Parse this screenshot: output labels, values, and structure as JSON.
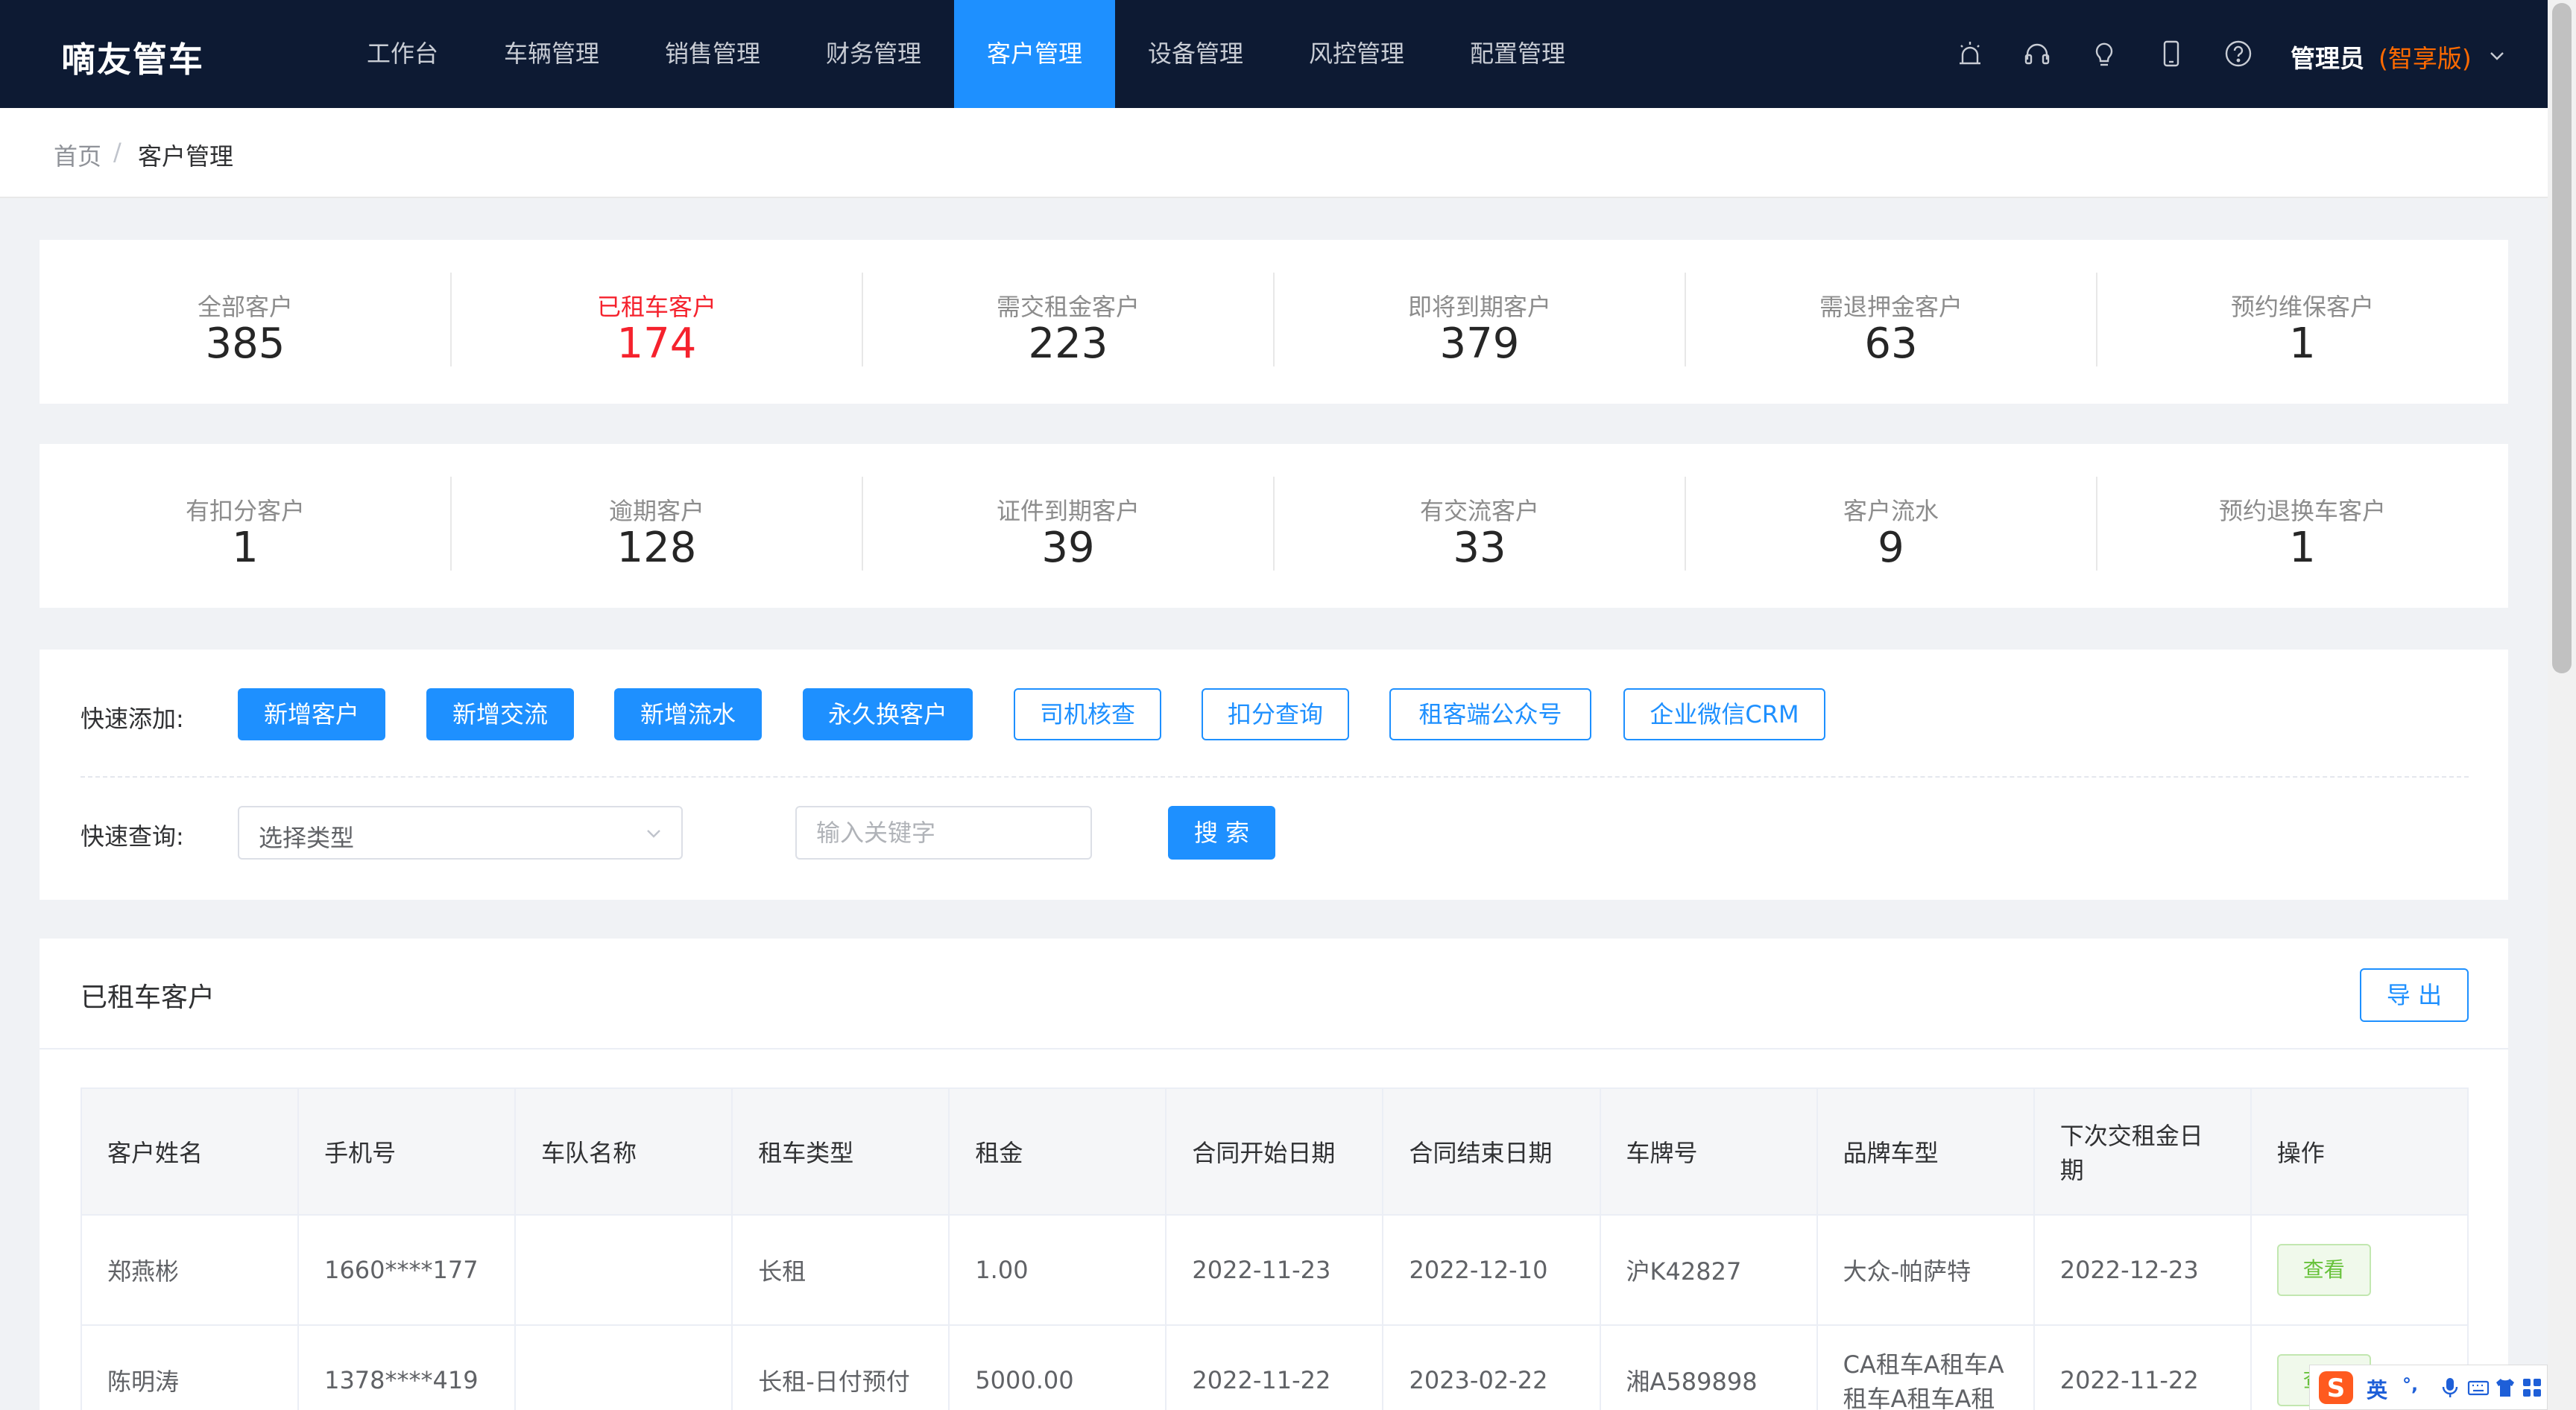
{
  "app": {
    "brand": "嘀友管车"
  },
  "nav": {
    "items": [
      {
        "label": "工作台"
      },
      {
        "label": "车辆管理"
      },
      {
        "label": "销售管理"
      },
      {
        "label": "财务管理"
      },
      {
        "label": "客户管理",
        "active": true
      },
      {
        "label": "设备管理"
      },
      {
        "label": "风控管理"
      },
      {
        "label": "配置管理"
      }
    ],
    "icons": [
      "alarm-icon",
      "headset-icon",
      "bulb-icon",
      "mobile-icon",
      "help-icon"
    ],
    "user": {
      "name": "管理员",
      "edition": "(智享版)"
    }
  },
  "breadcrumb": {
    "home": "首页",
    "separator": "/",
    "current": "客户管理"
  },
  "stats_row1": [
    {
      "label": "全部客户",
      "value": "385"
    },
    {
      "label": "已租车客户",
      "value": "174",
      "highlight": true
    },
    {
      "label": "需交租金客户",
      "value": "223"
    },
    {
      "label": "即将到期客户",
      "value": "379"
    },
    {
      "label": "需退押金客户",
      "value": "63"
    },
    {
      "label": "预约维保客户",
      "value": "1"
    }
  ],
  "stats_row2": [
    {
      "label": "有扣分客户",
      "value": "1"
    },
    {
      "label": "逾期客户",
      "value": "128"
    },
    {
      "label": "证件到期客户",
      "value": "39"
    },
    {
      "label": "有交流客户",
      "value": "33"
    },
    {
      "label": "客户流水",
      "value": "9"
    },
    {
      "label": "预约退换车客户",
      "value": "1"
    }
  ],
  "quick_add": {
    "label": "快速添加:",
    "solid_buttons": [
      "新增客户",
      "新增交流",
      "新增流水",
      "永久换客户"
    ],
    "outline_buttons": [
      "司机核查",
      "扣分查询",
      "租客端公众号",
      "企业微信CRM"
    ]
  },
  "quick_search": {
    "label": "快速查询:",
    "select_value": "选择类型",
    "keyword_placeholder": "输入关键字",
    "search_button": "搜 索"
  },
  "table_panel": {
    "title": "已租车客户",
    "export_button": "导 出",
    "columns": [
      "客户姓名",
      "手机号",
      "车队名称",
      "租车类型",
      "租金",
      "合同开始日期",
      "合同结束日期",
      "车牌号",
      "品牌车型",
      "下次交租金日期",
      "操作"
    ],
    "rows": [
      [
        "郑燕彬",
        "1660****177",
        "",
        "长租",
        "1.00",
        "2022-11-23",
        "2022-12-10",
        "沪K42827",
        "大众-帕萨特",
        "2022-12-23",
        "查看"
      ],
      [
        "陈明涛",
        "1378****419",
        "",
        "长租-日付预付",
        "5000.00",
        "2022-11-22",
        "2023-02-22",
        "湘A589898",
        "CA租车A租车A租车A租车A租",
        "2022-11-22",
        "查看"
      ]
    ]
  },
  "ime": {
    "lang": "英",
    "punct": "°,"
  },
  "colors": {
    "nav_bg": "#0d1a33",
    "accent": "#1e90ff",
    "highlight": "#f5222d",
    "edition": "#ff6a00",
    "view_green": "#67c23a"
  }
}
